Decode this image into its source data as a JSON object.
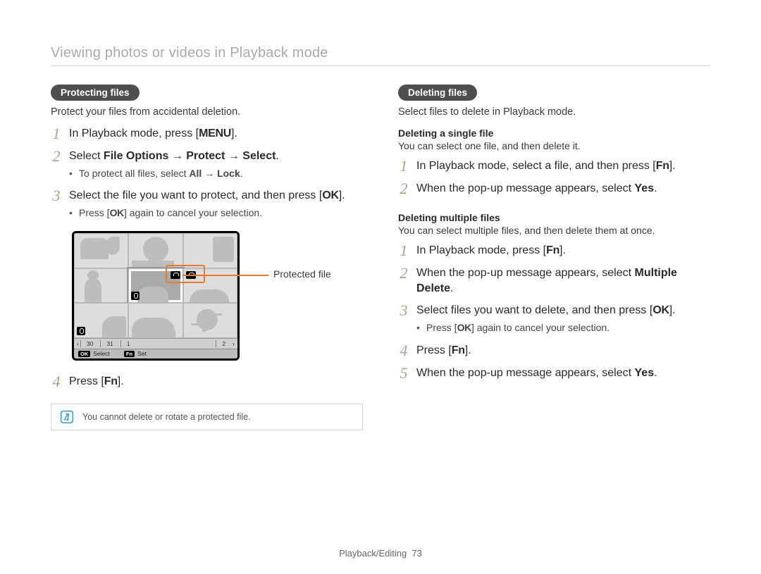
{
  "header": "Viewing photos or videos in Playback mode",
  "left": {
    "pill": "Protecting files",
    "intro": "Protect your files from accidental deletion.",
    "step1_a": "In Playback mode, press [",
    "step1_btn": "MENU",
    "step1_c": "].",
    "step2_a": "Select ",
    "step2_b": "File Options → Protect → Select",
    "step2_c": ".",
    "step2_bullet_a": "To protect all files, select ",
    "step2_bullet_b": "All → Lock",
    "step2_bullet_c": ".",
    "step3_a": "Select the file you want to protect, and then press [",
    "step3_btn": "OK",
    "step3_c": "].",
    "step3_bullet_a": "Press [",
    "step3_bullet_btn": "OK",
    "step3_bullet_c": "] again to cancel your selection.",
    "callout": "Protected file",
    "step4_a": "Press [",
    "step4_btn": "Fn",
    "step4_c": "].",
    "note": "You cannot delete or rotate a protected file."
  },
  "right": {
    "pill": "Deleting files",
    "intro": "Select files to delete in Playback mode.",
    "single_head": "Deleting a single file",
    "single_desc": "You can select one file, and then delete it.",
    "s_step1_a": "In Playback mode, select a file, and then press [",
    "s_step1_btn": "Fn",
    "s_step1_c": "].",
    "s_step2_a": "When the pop-up message appears, select ",
    "s_step2_b": "Yes",
    "s_step2_c": ".",
    "multi_head": "Deleting multiple files",
    "multi_desc": "You can select multiple files, and then delete them at once.",
    "m_step1_a": "In Playback mode, press [",
    "m_step1_btn": "Fn",
    "m_step1_c": "].",
    "m_step2_a": "When the pop-up message appears, select ",
    "m_step2_b": "Multiple Delete",
    "m_step2_c": ".",
    "m_step3_a": "Select files you want to delete, and then press [",
    "m_step3_btn": "OK",
    "m_step3_c": "].",
    "m_step3_bullet_a": "Press [",
    "m_step3_bullet_btn": "OK",
    "m_step3_bullet_c": "] again to cancel your selection.",
    "m_step4_a": "Press [",
    "m_step4_btn": "Fn",
    "m_step4_c": "].",
    "m_step5_a": "When the pop-up message appears, select ",
    "m_step5_b": "Yes",
    "m_step5_c": "."
  },
  "camera": {
    "date_prev": "‹",
    "d30": "30",
    "d31": "31",
    "d1": "1",
    "d2": "2",
    "date_next": "›",
    "sb_ok": "OK",
    "sb_select": "Select",
    "sb_fn": "Fn",
    "sb_set": "Set"
  },
  "footer_section": "Playback/Editing",
  "footer_page": "73"
}
